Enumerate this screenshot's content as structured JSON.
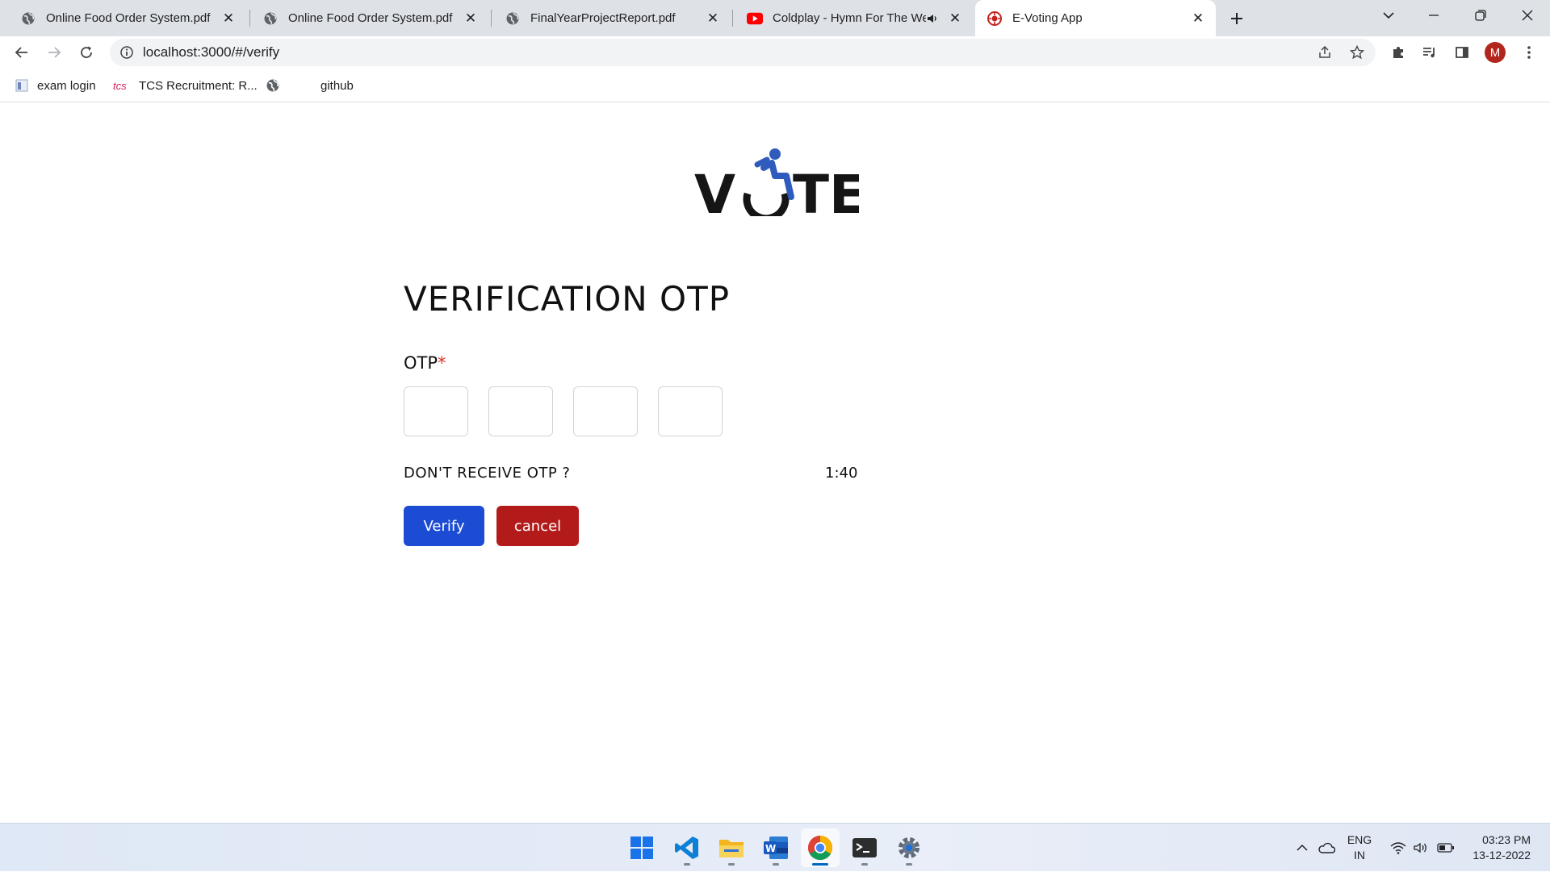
{
  "browser": {
    "tabs": [
      {
        "title": "Online Food Order System.pdf",
        "favicon": "globe-icon"
      },
      {
        "title": "Online Food Order System.pdf",
        "favicon": "globe-icon"
      },
      {
        "title": "FinalYearProjectReport.pdf",
        "favicon": "globe-icon"
      },
      {
        "title": "Coldplay - Hymn For The We",
        "favicon": "youtube-icon",
        "playing_audio": true
      },
      {
        "title": "E-Voting App",
        "favicon": "app-icon",
        "active": true
      }
    ],
    "url": "localhost:3000/#/verify",
    "profile_initial": "M",
    "bookmarks": [
      {
        "label": "exam login"
      },
      {
        "label": "TCS Recruitment: R..."
      },
      {
        "label": ""
      },
      {
        "label": "github"
      }
    ]
  },
  "page": {
    "logo_text_left": "V",
    "logo_text_right": "TE",
    "heading": "VERIFICATION OTP",
    "otp_label": "OTP",
    "otp_required_mark": "*",
    "otp_values": [
      "",
      "",
      "",
      ""
    ],
    "resend_text": "DON'T RECEIVE OTP ?",
    "timer": "1:40",
    "verify_label": "Verify",
    "cancel_label": "cancel"
  },
  "colors": {
    "verify": "#1c4bd4",
    "cancel": "#b31b1b",
    "logo_accent": "#2f5bbd",
    "required": "#d93025"
  },
  "taskbar": {
    "apps": [
      "windows-start-icon",
      "vscode-icon",
      "file-explorer-icon",
      "word-icon",
      "chrome-icon",
      "terminal-icon",
      "settings-icon"
    ],
    "language_line1": "ENG",
    "language_line2": "IN",
    "time": "03:23 PM",
    "date": "13-12-2022"
  }
}
